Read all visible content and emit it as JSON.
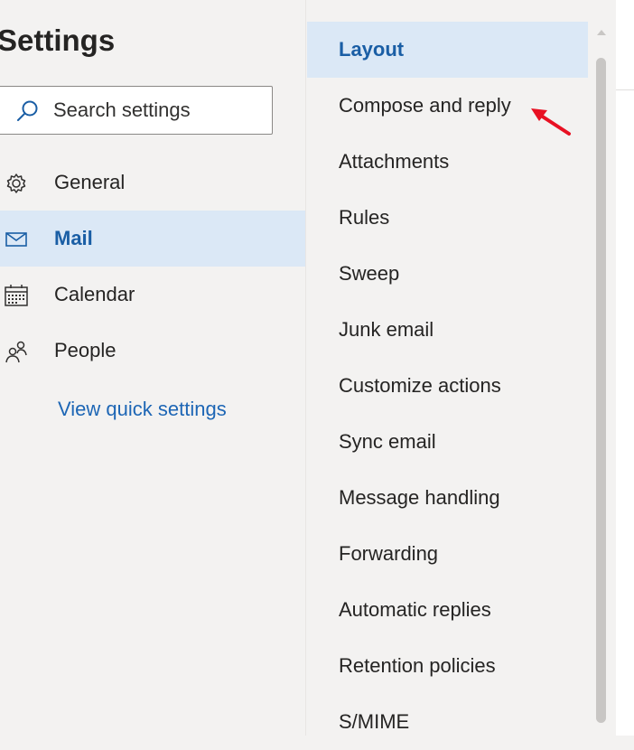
{
  "settings": {
    "title": "Settings",
    "search_placeholder": "Search settings",
    "nav": [
      {
        "label": "General",
        "icon": "gear-icon",
        "selected": false
      },
      {
        "label": "Mail",
        "icon": "mail-icon",
        "selected": true
      },
      {
        "label": "Calendar",
        "icon": "calendar-icon",
        "selected": false
      },
      {
        "label": "People",
        "icon": "people-icon",
        "selected": false
      }
    ],
    "quick_settings_link": "View quick settings"
  },
  "mail_menu": {
    "items": [
      "Layout",
      "Compose and reply",
      "Attachments",
      "Rules",
      "Sweep",
      "Junk email",
      "Customize actions",
      "Sync email",
      "Message handling",
      "Forwarding",
      "Automatic replies",
      "Retention policies",
      "S/MIME"
    ],
    "selected_index": 0
  },
  "colors": {
    "accent": "#1a5ea5",
    "selected_bg": "#dbe8f6",
    "pane_bg": "#f3f2f1",
    "annotation_arrow": "#e81123"
  }
}
